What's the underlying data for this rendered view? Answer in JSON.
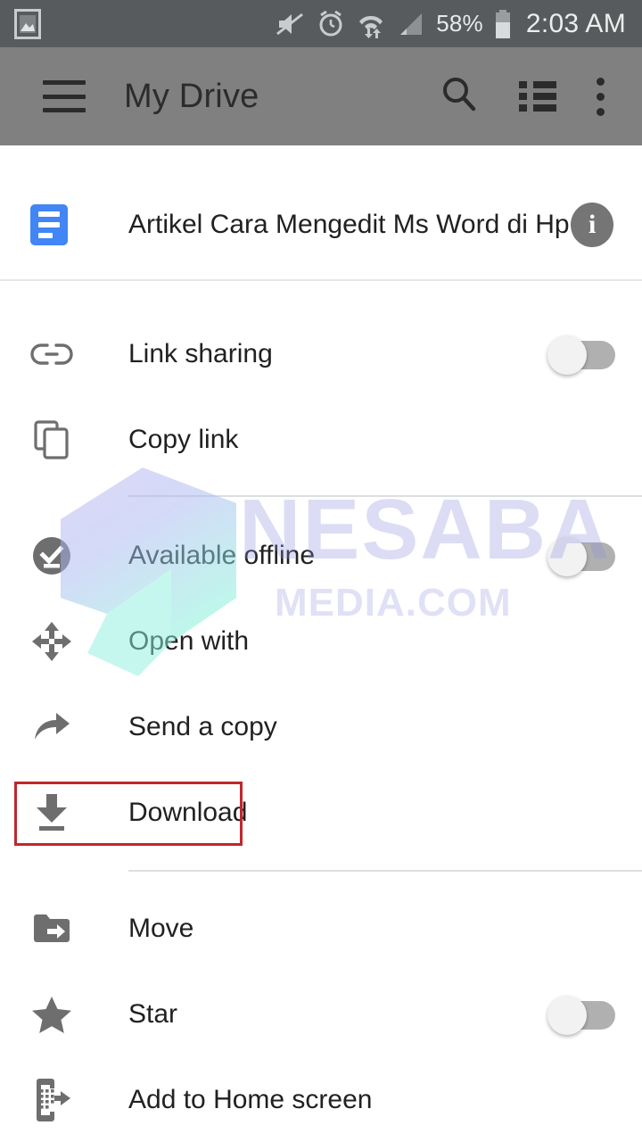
{
  "status_bar": {
    "left_icon": "screenshot-image-icon",
    "icons": [
      "volume-mute-icon",
      "alarm-clock-icon",
      "wifi-transfer-icon",
      "cellular-signal-icon"
    ],
    "battery_percent": "58%",
    "battery_icon": "battery-icon",
    "clock": "2:03 AM"
  },
  "app_bar": {
    "menu_icon": "hamburger-menu-icon",
    "title": "My Drive",
    "actions": [
      {
        "name": "search-icon"
      },
      {
        "name": "list-view-icon"
      },
      {
        "name": "overflow-menu-icon"
      }
    ]
  },
  "file": {
    "icon": "google-docs-file-icon",
    "name": "Artikel Cara Mengedit Ms Word di Hp...",
    "info_label": "i"
  },
  "menu": {
    "items": [
      {
        "id": "link-sharing",
        "label": "Link sharing",
        "icon": "link-icon",
        "toggle": "off"
      },
      {
        "id": "copy-link",
        "label": "Copy link",
        "icon": "copy-icon",
        "toggle": null
      },
      {
        "id": "available-offline",
        "label": "Available offline",
        "icon": "offline-pin-icon",
        "toggle": "off"
      },
      {
        "id": "open-with",
        "label": "Open with",
        "icon": "open-with-arrows-icon",
        "toggle": null
      },
      {
        "id": "send-a-copy",
        "label": "Send a copy",
        "icon": "share-arrow-icon",
        "toggle": null
      },
      {
        "id": "download",
        "label": "Download",
        "icon": "download-icon",
        "toggle": null
      },
      {
        "id": "move",
        "label": "Move",
        "icon": "move-folder-icon",
        "toggle": null
      },
      {
        "id": "star",
        "label": "Star",
        "icon": "star-icon",
        "toggle": "off"
      },
      {
        "id": "add-to-home-screen",
        "label": "Add to Home screen",
        "icon": "add-to-homescreen-icon",
        "toggle": null
      }
    ]
  },
  "annotation": {
    "highlight_target": "Download",
    "highlight_color": "#c0272d"
  },
  "watermark": {
    "main": "NESABA",
    "sub": "MEDIA.COM"
  },
  "colors": {
    "status_bar_bg": "#585b5e",
    "app_bar_scrim": "#808080",
    "accent_blue": "#4285f4",
    "icon_gray": "#6e6e6e",
    "text_primary": "#212121"
  }
}
